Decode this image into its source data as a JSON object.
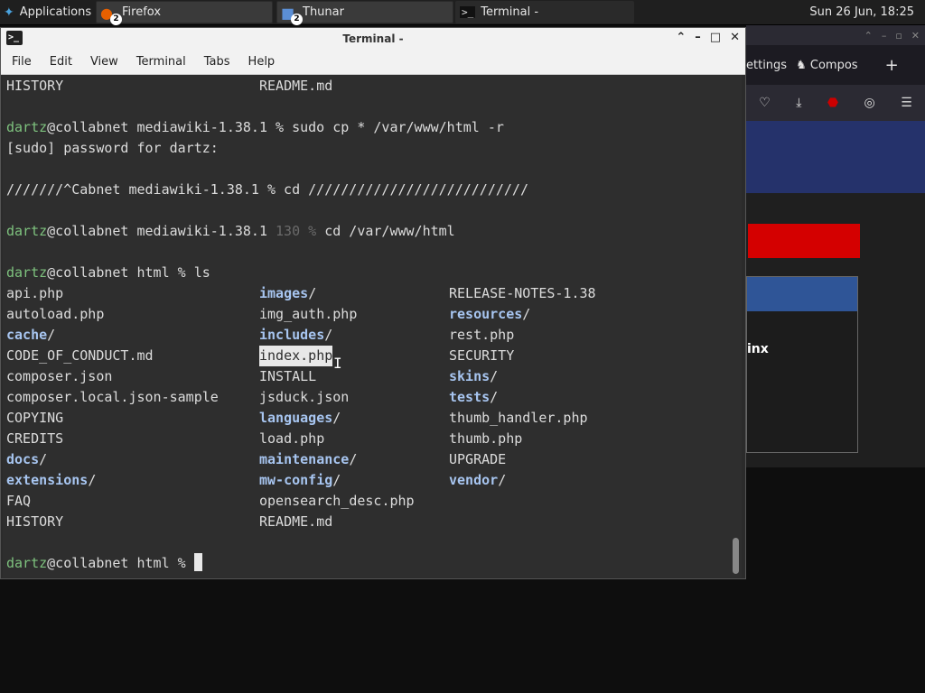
{
  "panel": {
    "apps_label": "Applications",
    "tasks": [
      {
        "label": "Firefox",
        "badge": "2"
      },
      {
        "label": "Thunar",
        "badge": "2"
      },
      {
        "label": "Terminal -"
      }
    ],
    "clock": "Sun 26 Jun, 18:25"
  },
  "firefox_bg": {
    "tab1": "ettings",
    "tab2": "Compos",
    "box_text": "inx"
  },
  "terminal": {
    "title": "Terminal -",
    "menu": [
      "File",
      "Edit",
      "View",
      "Terminal",
      "Tabs",
      "Help"
    ],
    "line_history_top": "HISTORY",
    "line_readme_top": "README.md",
    "prompt_user": "dartz",
    "cmd1_host": "@collabnet mediawiki-1.38.1 % sudo cp * /var/www/html -r",
    "sudo_prompt": "[sudo] password for dartz:",
    "garbled_line": "///////^Cabnet mediawiki-1.38.1 % cd ///////////////////////////",
    "cmd2_host": "@collabnet mediawiki-1.38.1 ",
    "cmd2_status": "130 %",
    "cmd2_cmd": " cd /var/www/html",
    "cmd3_host": "@collabnet html % ls",
    "final_prompt": "@collabnet html % ",
    "ls": {
      "col1": [
        "api.php",
        "autoload.php",
        "cache",
        "CODE_OF_CONDUCT.md",
        "composer.json",
        "composer.local.json-sample",
        "COPYING",
        "CREDITS",
        "docs",
        "extensions",
        "FAQ",
        "HISTORY"
      ],
      "col2": [
        "images",
        "img_auth.php",
        "includes",
        "index.php",
        "INSTALL",
        "jsduck.json",
        "languages",
        "load.php",
        "maintenance",
        "mw-config",
        "opensearch_desc.php",
        "README.md"
      ],
      "col3": [
        "RELEASE-NOTES-1.38",
        "resources",
        "rest.php",
        "SECURITY",
        "skins",
        "tests",
        "thumb_handler.php",
        "thumb.php",
        "UPGRADE",
        "vendor"
      ]
    }
  }
}
